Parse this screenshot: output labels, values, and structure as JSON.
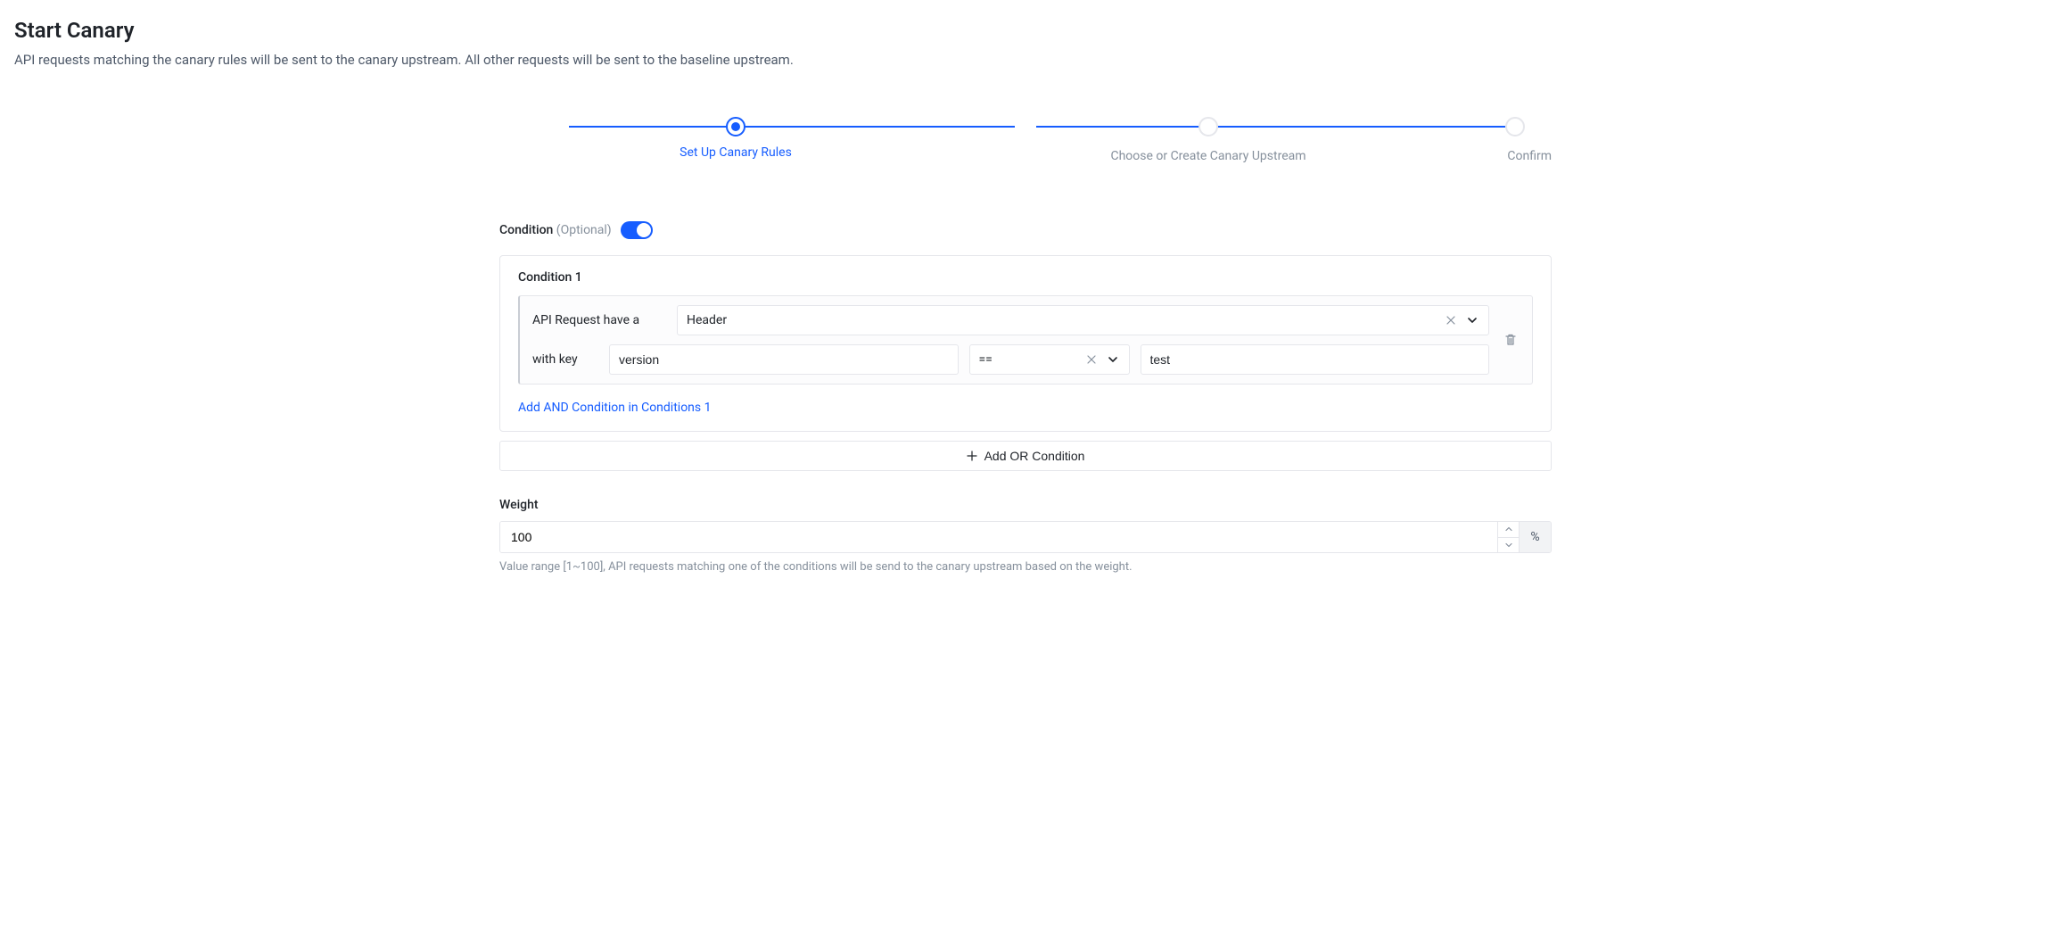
{
  "title": "Start Canary",
  "subtitle": "API requests matching the canary rules will be sent to the canary upstream. All other requests will be sent to the baseline upstream.",
  "stepper": {
    "steps": [
      {
        "label": "Set Up Canary Rules",
        "state": "active"
      },
      {
        "label": "Choose or Create Canary Upstream",
        "state": "pending"
      },
      {
        "label": "Confirm",
        "state": "pending"
      }
    ]
  },
  "condition_section": {
    "label": "Condition",
    "optional": "(Optional)",
    "enabled": true
  },
  "condition": {
    "title": "Condition 1",
    "rule": {
      "label_have_a": "API Request have a",
      "type_value": "Header",
      "label_with_key": "with key",
      "key_value": "version",
      "operator_value": "==",
      "match_value": "test"
    },
    "add_and_label": "Add AND Condition in Conditions 1"
  },
  "add_or_label": "Add OR Condition",
  "weight": {
    "label": "Weight",
    "value": "100",
    "unit": "%",
    "help": "Value range [1~100], API requests matching one of the conditions will be send to the canary upstream based on the weight."
  }
}
